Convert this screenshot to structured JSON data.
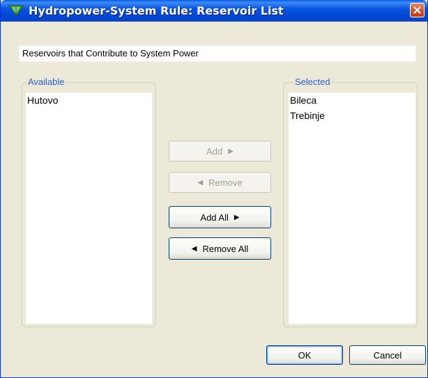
{
  "window": {
    "title": "Hydropower-System Rule: Reservoir List"
  },
  "header": {
    "text": "Reservoirs that Contribute to System Power"
  },
  "available": {
    "legend": "Available",
    "items": [
      "Hutovo"
    ]
  },
  "selected": {
    "legend": "Selected",
    "items": [
      "Bileca",
      "Trebinje"
    ]
  },
  "buttons": {
    "add": "Add",
    "remove": "Remove",
    "add_all": "Add All",
    "remove_all": "Remove All",
    "ok": "OK",
    "cancel": "Cancel"
  },
  "icons": {
    "right_arrow": "▶",
    "left_arrow": "◀"
  },
  "colors": {
    "titlebar": "#0a55e0",
    "legend_text": "#2a61d0",
    "window_bg": "#ece9d8"
  }
}
